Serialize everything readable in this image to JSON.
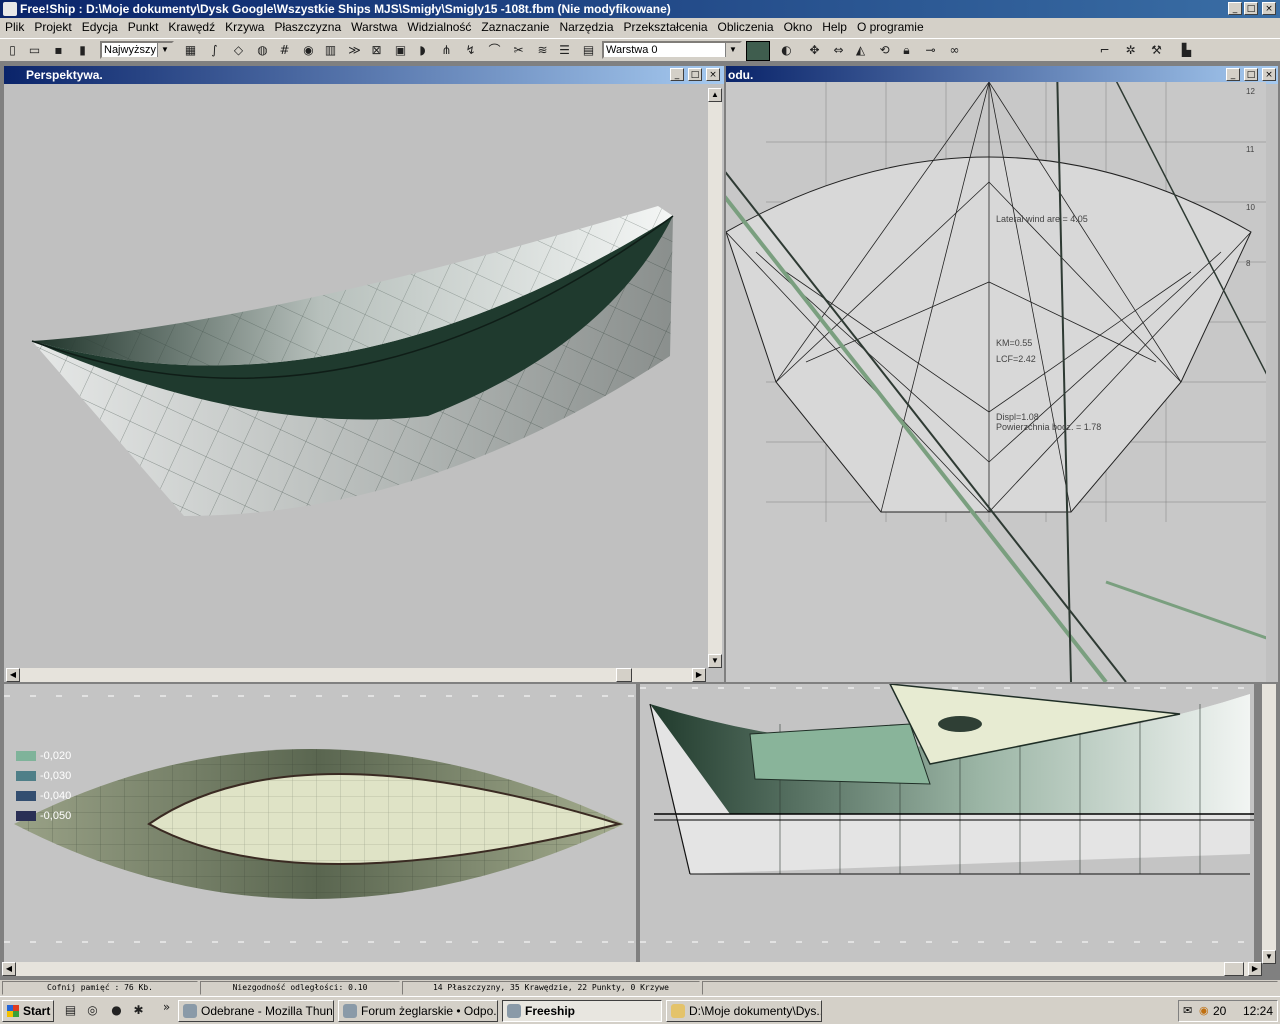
{
  "window": {
    "title": "Free!Ship : D:\\Moje dokumenty\\Dysk Google\\Wszystkie Ships MJS\\Smigły\\Smigly15 -108t.fbm (Nie modyfikowane)",
    "min": "_",
    "max": "□",
    "close": "×"
  },
  "menu": [
    "Plik",
    "Projekt",
    "Edycja",
    "Punkt",
    "Krawędź",
    "Krzywa",
    "Płaszczyzna",
    "Warstwa",
    "Widzialność",
    "Zaznaczanie",
    "Narzędzia",
    "Przekształcenia",
    "Obliczenia",
    "Okno",
    "Help",
    "O programie"
  ],
  "toolbar": {
    "precision_value": "Najwyższy",
    "layer_value": "Warstwa 0",
    "layer_color": "#3f5d4e"
  },
  "viewports": {
    "perspective": {
      "title": "Perspektywa."
    },
    "body_plan": {
      "title": "odu.",
      "labels": {
        "lateral": "Lateral wind are = 4.05",
        "km": "KM=0.55",
        "lcf": "LCF=2.42",
        "displ": "Displ=1.08",
        "surface": "Powierzchnia bocz. = 1.78"
      },
      "ticks": [
        "12",
        "11",
        "10",
        "8"
      ]
    },
    "plan": {
      "legend": [
        {
          "value": "-0,020",
          "color": "#7fb39a"
        },
        {
          "value": "-0,030",
          "color": "#4f7f88"
        },
        {
          "value": "-0,040",
          "color": "#334e70"
        },
        {
          "value": "-0,050",
          "color": "#2a2f55"
        }
      ]
    }
  },
  "status": {
    "undo": "Cofnij pamięć : 76 Kb.",
    "tolerance": "Niezgodność odległości: 0.10",
    "counts": "14 Płaszczyzny, 35 Krawędzie, 22 Punkty, 0 Krzywe"
  },
  "taskbar": {
    "start": "Start",
    "more": "»",
    "tasks": [
      {
        "label": "Odebrane - Mozilla Thun..."
      },
      {
        "label": "Forum żeglarskie • Odpo..."
      },
      {
        "label": "Freeship"
      },
      {
        "label": "D:\\Moje dokumenty\\Dys..."
      }
    ],
    "tray_temp": "20",
    "clock": "12:24"
  }
}
